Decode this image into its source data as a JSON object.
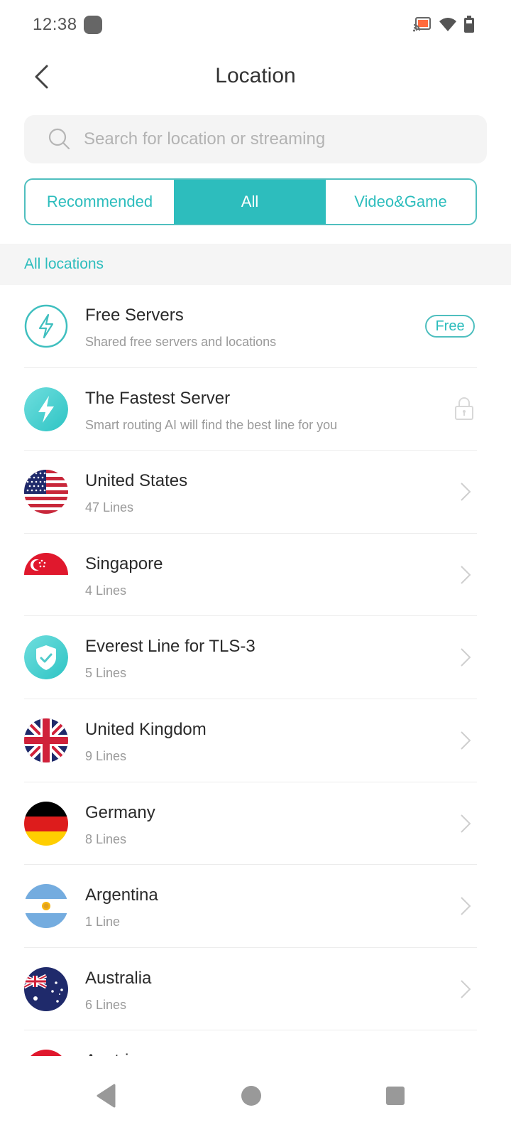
{
  "status_bar": {
    "time": "12:38",
    "icons": [
      "notification-icon",
      "cast-icon",
      "wifi-icon",
      "battery-icon"
    ]
  },
  "header": {
    "title": "Location",
    "back_icon": "chevron-left-icon"
  },
  "search": {
    "placeholder": "Search for location or streaming",
    "value": ""
  },
  "tabs": [
    {
      "label": "Recommended",
      "active": false
    },
    {
      "label": "All",
      "active": true
    },
    {
      "label": "Video&Game",
      "active": false
    }
  ],
  "section": {
    "label": "All locations"
  },
  "colors": {
    "accent": "#2dbdbd",
    "title_text": "#333333",
    "subtitle_text": "#9a9a9a",
    "section_bg": "#f5f5f5",
    "search_bg": "#f4f4f4"
  },
  "locations": [
    {
      "name": "Free Servers",
      "subtitle": "Shared free servers and locations",
      "icon": "lightning-outline-icon",
      "right": "badge",
      "badge": "Free"
    },
    {
      "name": "The Fastest Server",
      "subtitle": "Smart routing AI will find the best line for you",
      "icon": "lightning-filled-icon",
      "right": "lock"
    },
    {
      "name": "United States",
      "subtitle": "47 Lines",
      "icon": "flag-us-icon",
      "right": "chevron"
    },
    {
      "name": "Singapore",
      "subtitle": "4 Lines",
      "icon": "flag-sg-icon",
      "right": "chevron"
    },
    {
      "name": "Everest Line for TLS-3",
      "subtitle": "5 Lines",
      "icon": "shield-check-icon",
      "right": "chevron"
    },
    {
      "name": "United Kingdom",
      "subtitle": "9 Lines",
      "icon": "flag-uk-icon",
      "right": "chevron"
    },
    {
      "name": "Germany",
      "subtitle": "8 Lines",
      "icon": "flag-de-icon",
      "right": "chevron"
    },
    {
      "name": "Argentina",
      "subtitle": "1 Line",
      "icon": "flag-ar-icon",
      "right": "chevron"
    },
    {
      "name": "Australia",
      "subtitle": "6 Lines",
      "icon": "flag-au-icon",
      "right": "chevron"
    },
    {
      "name": "Austria",
      "subtitle": "",
      "icon": "flag-at-icon",
      "right": "chevron"
    }
  ],
  "nav_bar": {
    "buttons": [
      "back-nav-icon",
      "home-nav-icon",
      "recents-nav-icon"
    ]
  }
}
